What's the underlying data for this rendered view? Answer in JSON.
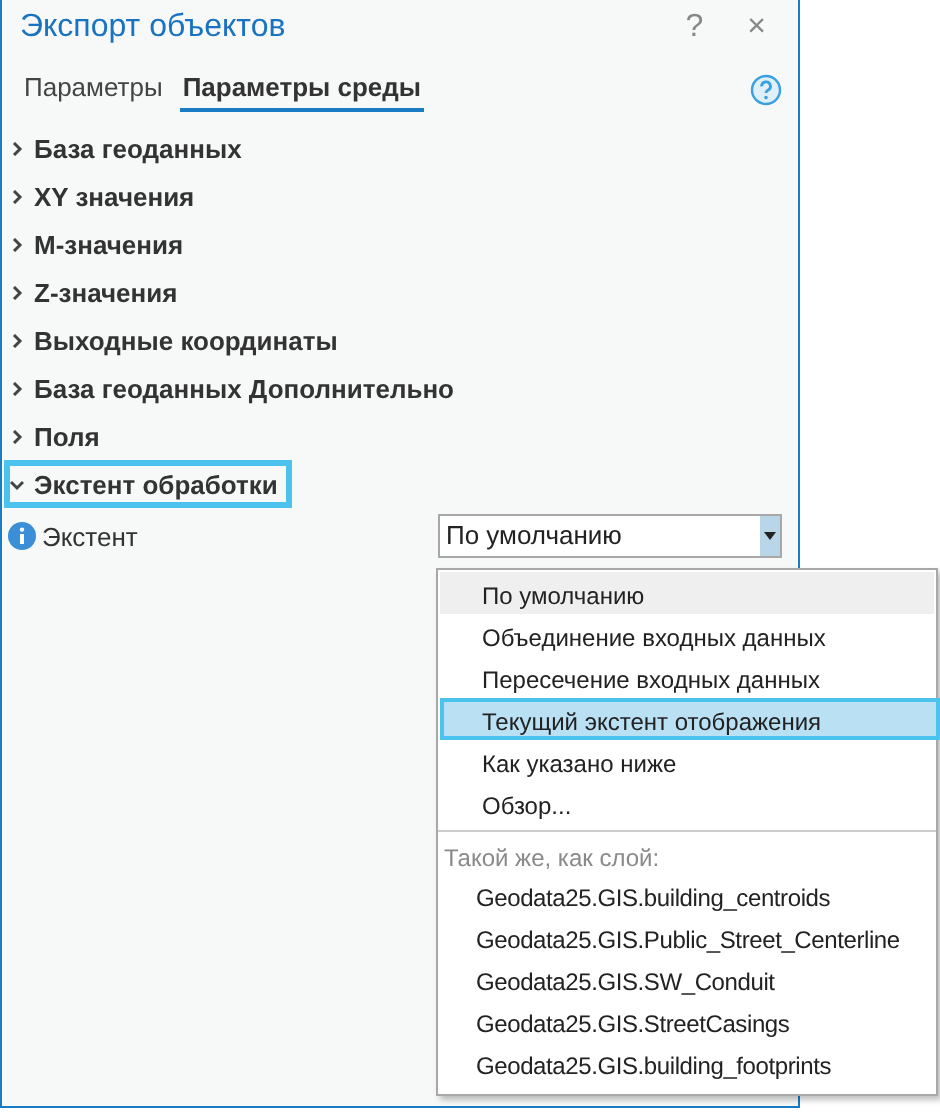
{
  "window": {
    "title": "Экспорт объектов",
    "help_glyph": "?",
    "close_glyph": "×"
  },
  "tabs": [
    {
      "label": "Параметры",
      "selected": false
    },
    {
      "label": "Параметры среды",
      "selected": true
    }
  ],
  "sections": [
    {
      "label": "База геоданных",
      "expanded": false,
      "focused": false
    },
    {
      "label": "XY значения",
      "expanded": false,
      "focused": false
    },
    {
      "label": "M-значения",
      "expanded": false,
      "focused": false
    },
    {
      "label": "Z-значения",
      "expanded": false,
      "focused": false
    },
    {
      "label": "Выходные координаты",
      "expanded": false,
      "focused": false
    },
    {
      "label": "База геоданных Дополнительно",
      "expanded": false,
      "focused": false
    },
    {
      "label": "Поля",
      "expanded": false,
      "focused": false
    },
    {
      "label": "Экстент обработки",
      "expanded": true,
      "focused": true
    }
  ],
  "extent_field": {
    "label": "Экстент",
    "value": "По умолчанию"
  },
  "dropdown": {
    "options": [
      {
        "label": "По умолчанию",
        "hovered": true,
        "selected": false
      },
      {
        "label": "Объединение входных данных",
        "hovered": false,
        "selected": false
      },
      {
        "label": "Пересечение входных данных",
        "hovered": false,
        "selected": false
      },
      {
        "label": "Текущий экстент отображения",
        "hovered": false,
        "selected": true
      },
      {
        "label": "Как указано ниже",
        "hovered": false,
        "selected": false
      },
      {
        "label": "Обзор...",
        "hovered": false,
        "selected": false
      }
    ],
    "group_label": "Такой же, как слой:",
    "layers": [
      "Geodata25.GIS.building_centroids",
      "Geodata25.GIS.Public_Street_Centerline",
      "Geodata25.GIS.SW_Conduit",
      "Geodata25.GIS.StreetCasings",
      "Geodata25.GIS.building_footprints"
    ]
  }
}
